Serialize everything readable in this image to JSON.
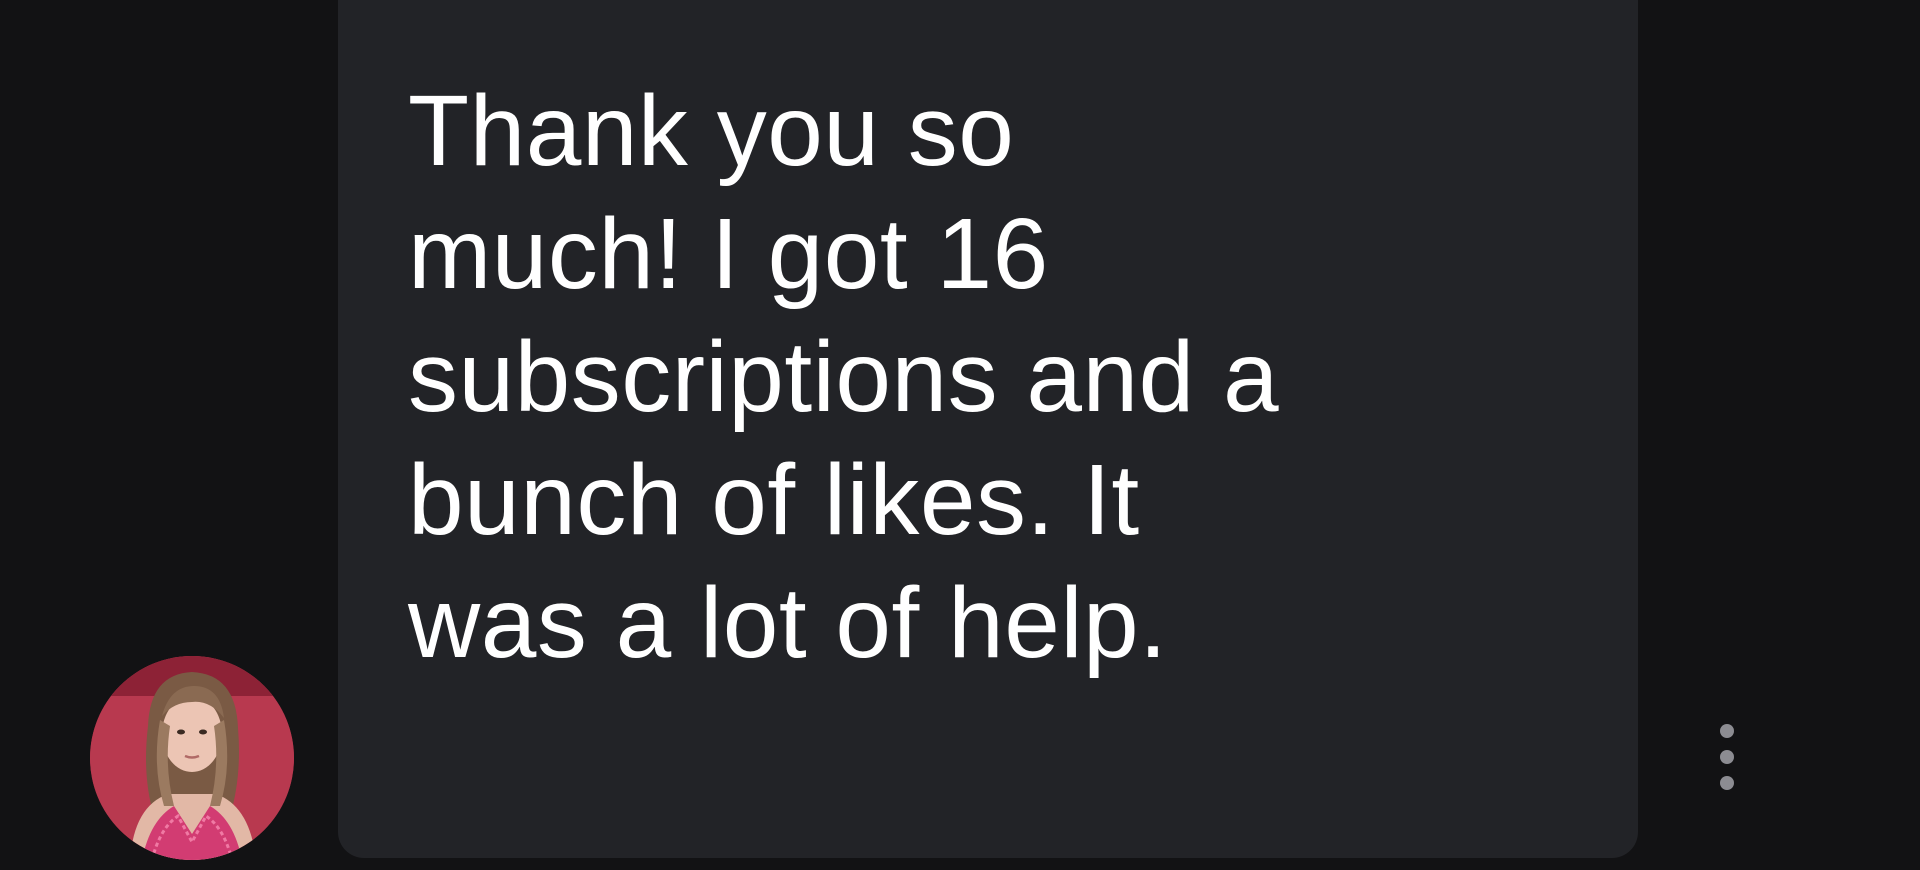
{
  "message": {
    "text": "Thank you so\nmuch! I got 16\nsubscriptions and a\nbunch of likes. It\nwas a lot of help."
  },
  "sender": {
    "avatar_icon": "user-avatar-photo"
  },
  "actions": {
    "more_icon": "vertical-ellipsis-icon"
  },
  "colors": {
    "background": "#121214",
    "bubble": "#222327",
    "text": "#ffffff",
    "more_dots": "#8c8c92"
  }
}
